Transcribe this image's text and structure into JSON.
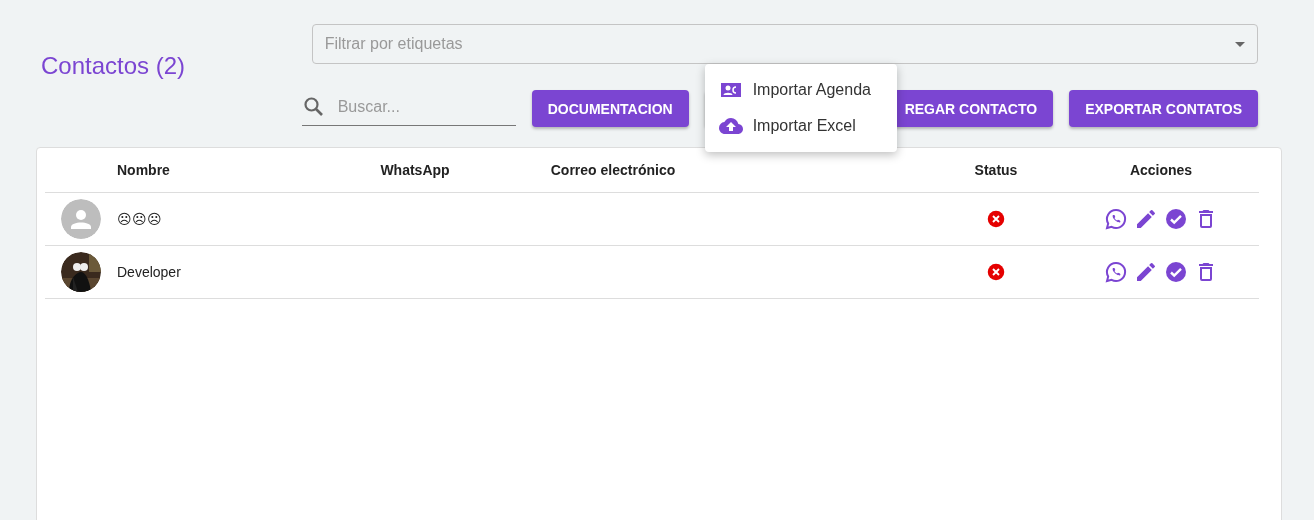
{
  "title": "Contactos (2)",
  "tag_filter": {
    "placeholder": "Filtrar por etiquetas"
  },
  "search": {
    "placeholder": "Buscar..."
  },
  "buttons": [
    "DOCUMENTACION",
    "REGAR CONTACTO",
    "EXPORTAR CONTATOS"
  ],
  "import_menu": [
    {
      "kind": "agenda",
      "label": "Importar Agenda"
    },
    {
      "kind": "excel",
      "label": "Importar Excel"
    }
  ],
  "table": {
    "columns": [
      "Nombre",
      "WhatsApp",
      "Correo electrónico",
      "Status",
      "Acciones"
    ],
    "rows": [
      {
        "kind": "default",
        "name": "☹☹☹",
        "connected": false
      },
      {
        "kind": "picture",
        "name": "Developer",
        "connected": false
      }
    ]
  }
}
